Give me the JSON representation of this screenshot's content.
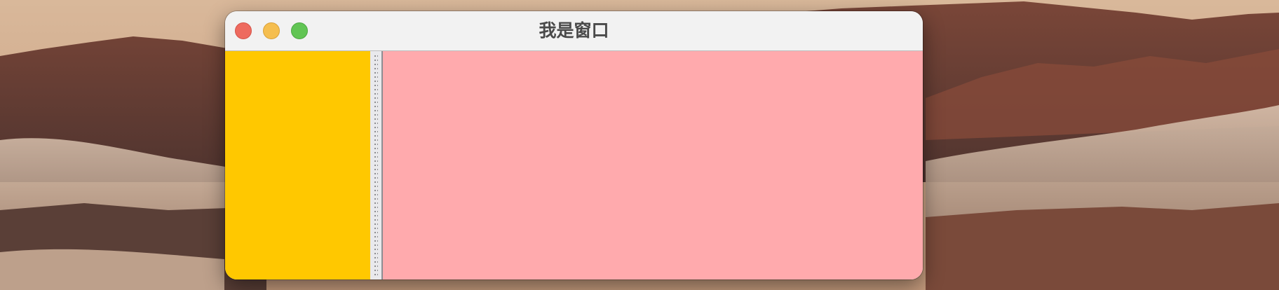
{
  "window": {
    "title": "我是窗口",
    "controls": {
      "close": "close-icon",
      "minimize": "minimize-icon",
      "zoom": "zoom-icon"
    }
  },
  "panes": {
    "left_color": "#ffc800",
    "right_color": "#ffaaad",
    "divider_icon": "split-drag-handle-icon"
  }
}
